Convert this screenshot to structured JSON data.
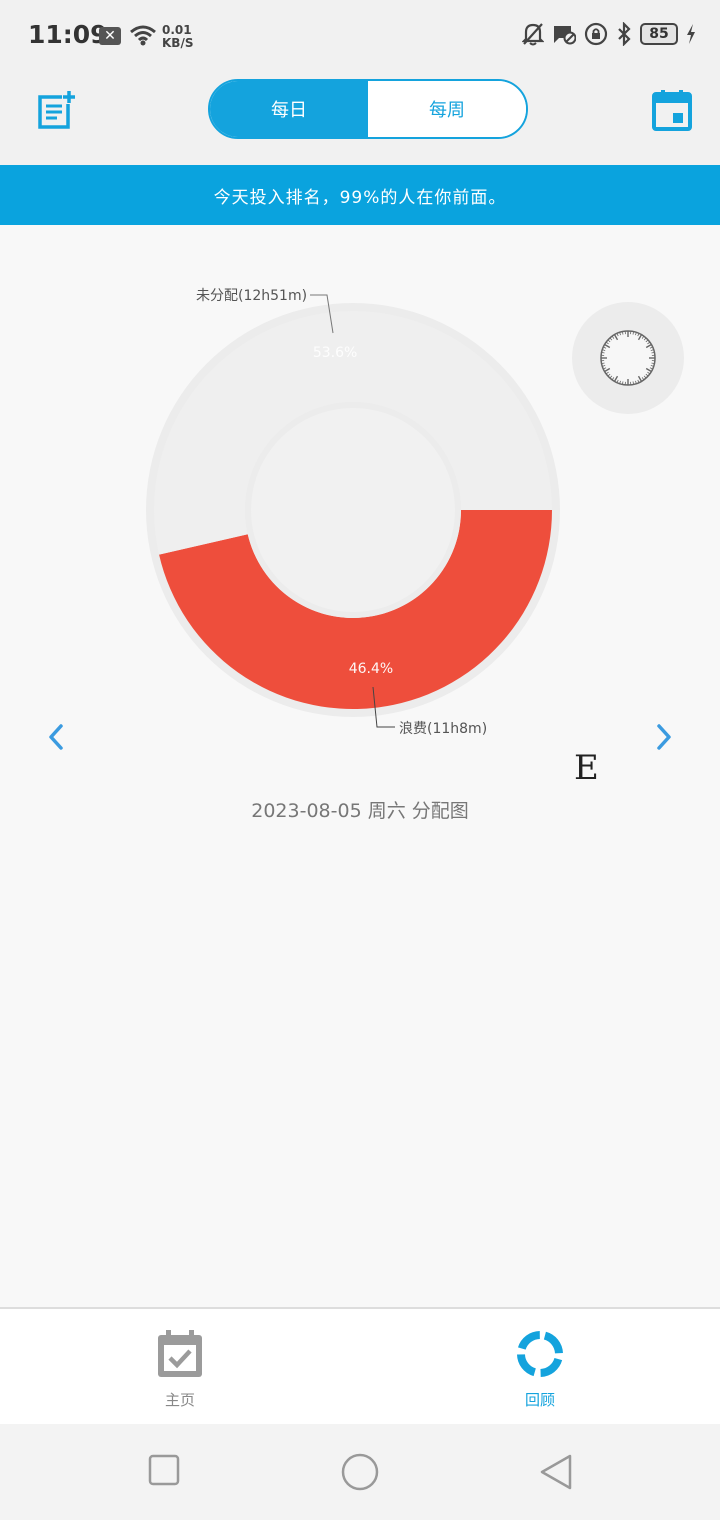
{
  "status_bar": {
    "time": "11:09",
    "x_badge": "✕",
    "net_speed_value": "0.01",
    "net_speed_unit": "KB/S",
    "battery": "85"
  },
  "header": {
    "tabs": [
      {
        "label": "每日",
        "active": true
      },
      {
        "label": "每周",
        "active": false
      }
    ]
  },
  "banner": {
    "text": "今天投入排名，99%的人在你前面。"
  },
  "chart_data": {
    "type": "pie",
    "donut": true,
    "categories": [
      "未分配",
      "浪费"
    ],
    "values": [
      53.6,
      46.4
    ],
    "durations": [
      "12h51m",
      "11h8m"
    ],
    "labels": [
      "未分配(12h51m)",
      "浪费(11h8m)"
    ],
    "percent_labels": [
      "53.6%",
      "46.4%"
    ],
    "colors": [
      "#efefef",
      "#ee4e3c"
    ],
    "title": "2023-08-05 周六 分配图"
  },
  "mark_letter": "E",
  "tab_bar": {
    "items": [
      {
        "label": "主页",
        "active": false
      },
      {
        "label": "回顾",
        "active": true
      }
    ]
  },
  "colors": {
    "accent": "#14a3dd",
    "banner": "#0aa3de",
    "waste": "#ee4e3c",
    "unallocated": "#efefef",
    "nav_arrow": "#3b9be0"
  }
}
